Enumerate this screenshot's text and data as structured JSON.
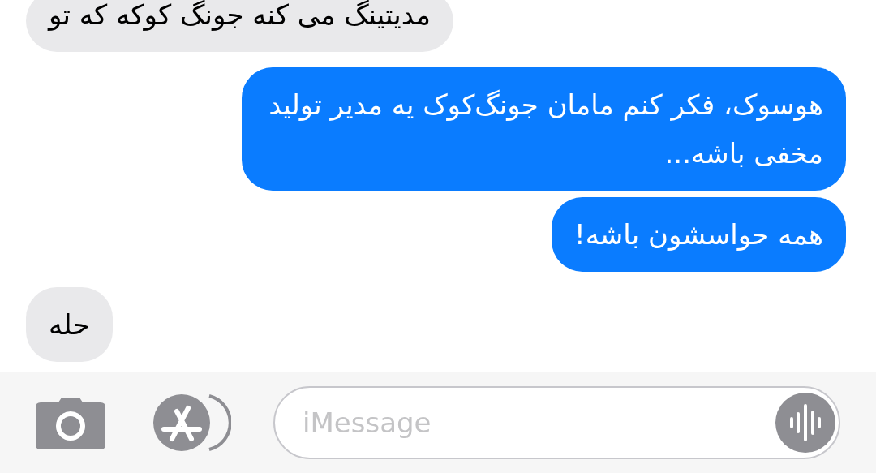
{
  "messages": [
    {
      "kind": "incoming",
      "text": "مدیتینگ می کنه جونگ کوکه که تو"
    },
    {
      "kind": "outgoing",
      "text": "هوسوک، فکر کنم مامان جونگ‌کوک یه مدیر تولید مخفی باشه..."
    },
    {
      "kind": "outgoing",
      "text": "همه حواسشون باشه!"
    },
    {
      "kind": "incoming",
      "text": "حله"
    }
  ],
  "composer": {
    "placeholder": "iMessage"
  }
}
